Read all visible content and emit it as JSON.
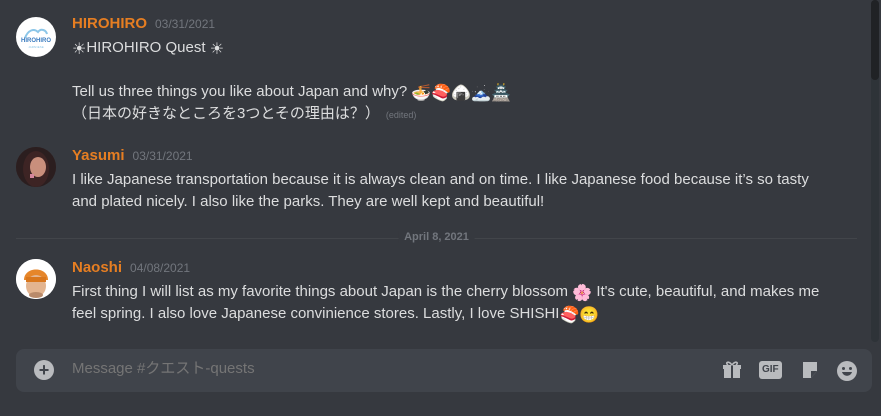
{
  "messages": [
    {
      "username": "HIROHIRO",
      "timestamp": "03/31/2021",
      "avatar_text": "HIROHIRO",
      "lines": [
        "HIROHIRO Quest",
        "Tell us three things you like about Japan and why?",
        "（日本の好きなところを3つとその理由は？）"
      ],
      "edited": "(edited)"
    },
    {
      "username": "Yasumi",
      "timestamp": "03/31/2021",
      "lines": [
        "I like Japanese transportation because it is always clean and on time. I like Japanese food because it’s so tasty",
        "and plated nicely. I also like the parks. They are well kept and beautiful!"
      ]
    },
    {
      "username": "Naoshi",
      "timestamp": "04/08/2021",
      "lines": [
        "First thing I will list as my favorite things about Japan is the cherry blossom",
        "It's cute, beautiful, and makes me",
        "feel spring. I also love Japanese convinience stores. Lastly, I love SHISHI"
      ]
    }
  ],
  "date_divider": "April 8, 2021",
  "composer": {
    "placeholder": "Message #クエスト-quests",
    "gif_label": "GIF"
  },
  "colors": {
    "background": "#36393f",
    "username": "#e67e22",
    "timestamp": "#72767d",
    "composer": "#40444b"
  },
  "icons": [
    "sun-icon",
    "ramen-icon",
    "sushi-icon",
    "rice-ball-icon",
    "mount-fuji-icon",
    "castle-icon",
    "cherry-blossom-icon",
    "grinning-face-icon",
    "attach-icon",
    "gift-icon",
    "gif-icon",
    "sticker-icon",
    "emoji-picker-icon"
  ]
}
